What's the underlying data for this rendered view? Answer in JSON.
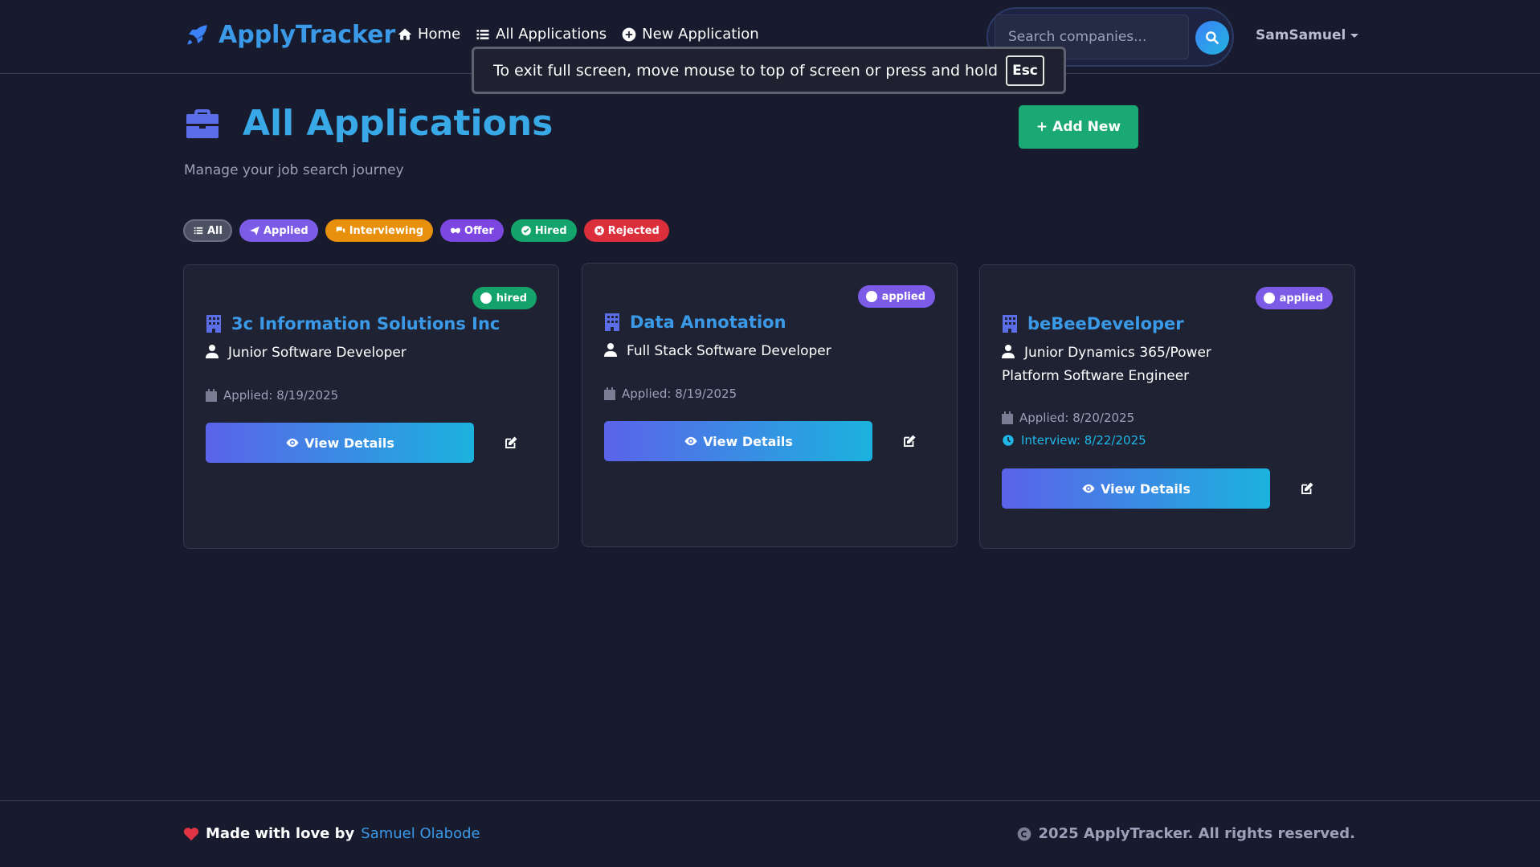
{
  "brand": {
    "name": "ApplyTracker"
  },
  "nav": {
    "home": "Home",
    "all_applications": "All Applications",
    "new_application": "New Application"
  },
  "search": {
    "placeholder": "Search companies..."
  },
  "user": {
    "name": "SamSamuel"
  },
  "toast": {
    "message": "To exit full screen, move mouse to top of screen or press and hold",
    "key": "Esc"
  },
  "header": {
    "title": "All Applications",
    "subtitle": "Manage your job search journey",
    "add_button": "Add New"
  },
  "filters": [
    {
      "label": "All",
      "color": "#4b5063"
    },
    {
      "label": "Applied",
      "color": "#7c5ce6"
    },
    {
      "label": "Interviewing",
      "color": "#e8900c"
    },
    {
      "label": "Offer",
      "color": "#7c46e0"
    },
    {
      "label": "Hired",
      "color": "#14a36a"
    },
    {
      "label": "Rejected",
      "color": "#dc2f3c"
    }
  ],
  "cards": [
    {
      "status": "hired",
      "status_color": "#14a36a",
      "company": "3c Information Solutions Inc",
      "position": "Junior Software Developer",
      "applied": "Applied: 8/19/2025",
      "interview": "",
      "view_label": "View Details"
    },
    {
      "status": "applied",
      "status_color": "#7c5ce6",
      "company": "Data Annotation",
      "position": "Full Stack Software Developer",
      "applied": "Applied: 8/19/2025",
      "interview": "",
      "view_label": "View Details"
    },
    {
      "status": "applied",
      "status_color": "#7c5ce6",
      "company": "beBeeDeveloper",
      "position": "Junior Dynamics 365/Power Platform Software Engineer",
      "applied": "Applied: 8/20/2025",
      "interview": "Interview: 8/22/2025",
      "view_label": "View Details"
    }
  ],
  "footer": {
    "made_with": "Made with love by",
    "author": "Samuel Olabode",
    "copyright": "2025 ApplyTracker. All rights reserved."
  }
}
